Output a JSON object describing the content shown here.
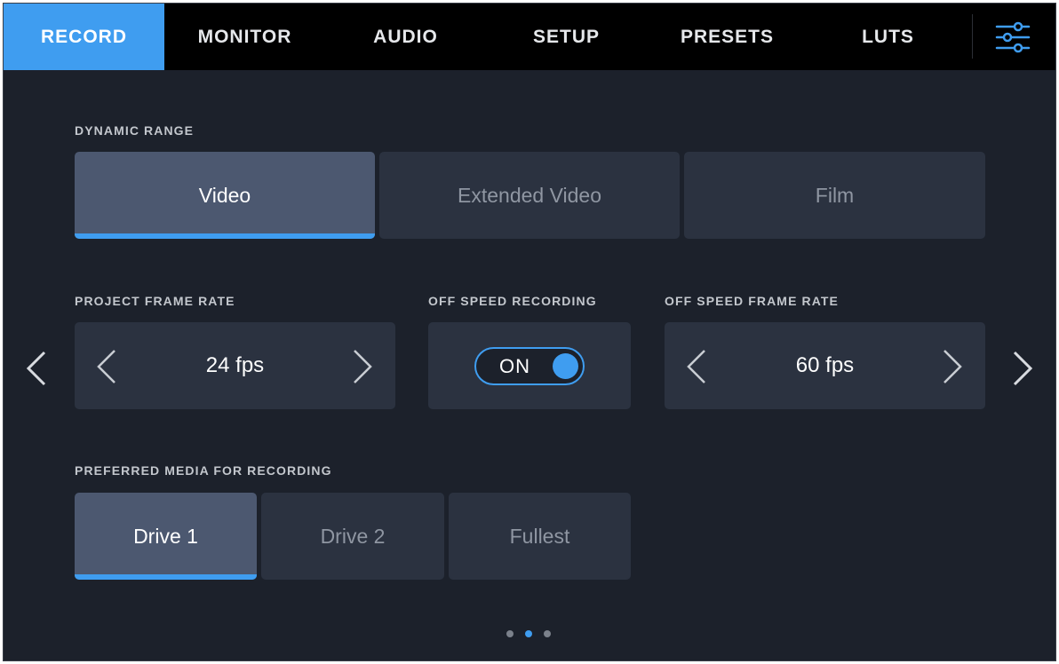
{
  "tabs": [
    {
      "label": "RECORD",
      "active": true
    },
    {
      "label": "MONITOR",
      "active": false
    },
    {
      "label": "AUDIO",
      "active": false
    },
    {
      "label": "SETUP",
      "active": false
    },
    {
      "label": "PRESETS",
      "active": false
    },
    {
      "label": "LUTS",
      "active": false
    }
  ],
  "menu_icon": "sliders-icon",
  "dynamic_range": {
    "label": "DYNAMIC RANGE",
    "options": [
      "Video",
      "Extended Video",
      "Film"
    ],
    "selected": "Video"
  },
  "project_frame_rate": {
    "label": "PROJECT FRAME RATE",
    "value": "24 fps"
  },
  "off_speed_recording": {
    "label": "OFF SPEED RECORDING",
    "state": "ON"
  },
  "off_speed_frame_rate": {
    "label": "OFF SPEED FRAME RATE",
    "value": "60 fps"
  },
  "preferred_media": {
    "label": "PREFERRED MEDIA FOR RECORDING",
    "options": [
      "Drive 1",
      "Drive 2",
      "Fullest"
    ],
    "selected": "Drive 1"
  },
  "pagination": {
    "total": 3,
    "current": 2
  },
  "colors": {
    "accent": "#3f9df0",
    "background": "#1c212b",
    "card": "#2b3240",
    "card_selected": "#4c5870"
  }
}
